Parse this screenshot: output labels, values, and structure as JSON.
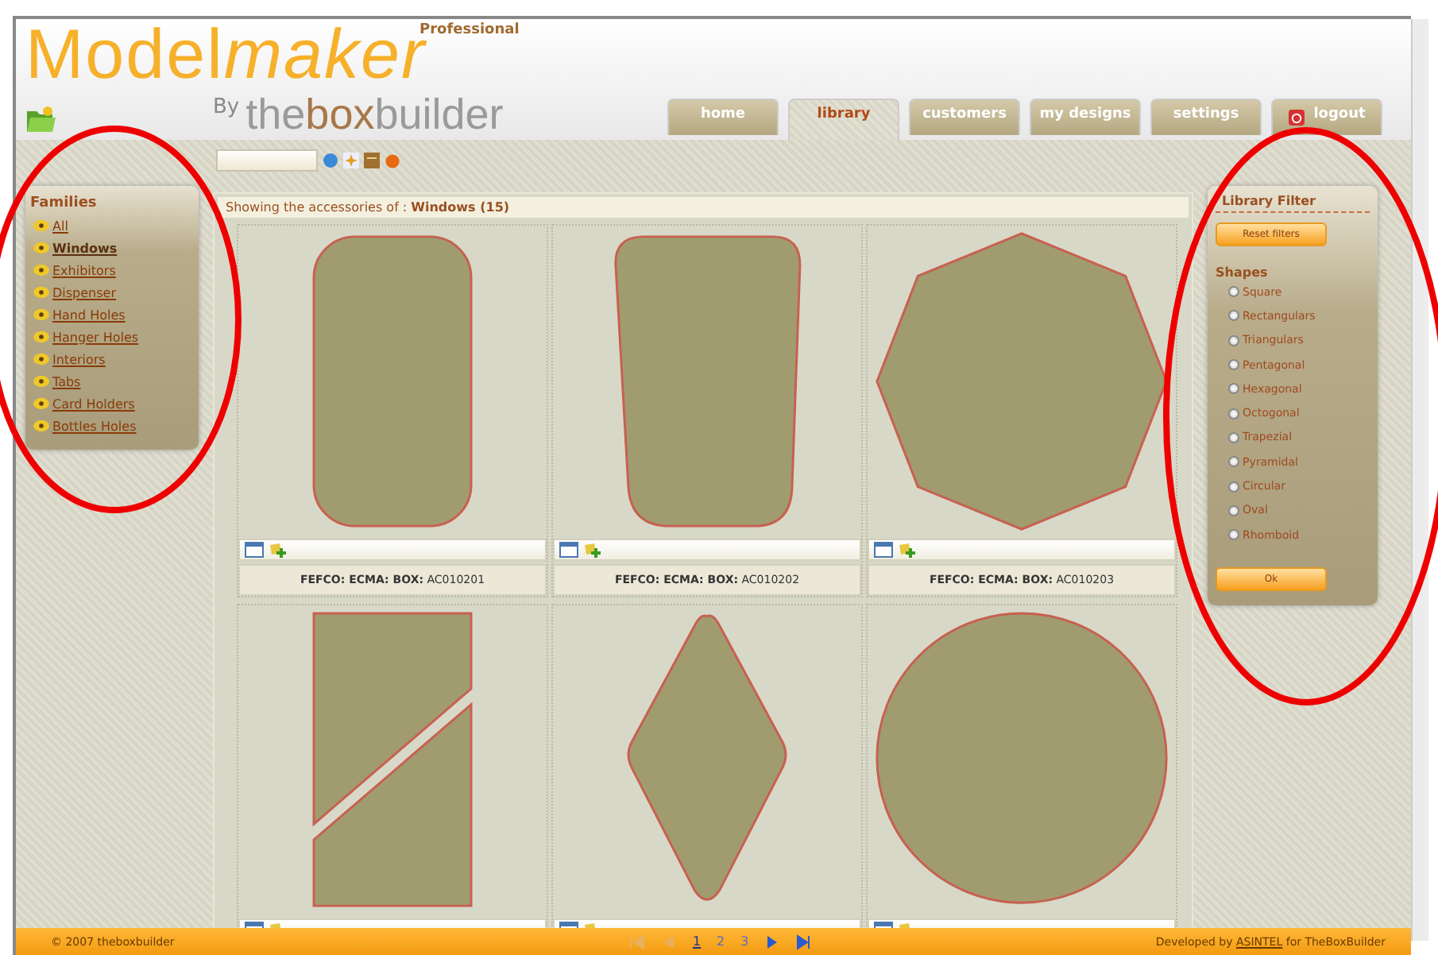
{
  "logo": {
    "brand": "Model",
    "brand_accent": "maker",
    "edition": "Professional",
    "by": "By",
    "company_a": "the",
    "company_b": "box",
    "company_c": "builder"
  },
  "tabs": [
    {
      "label": "home",
      "selected": false,
      "kind": "plain"
    },
    {
      "label": "library",
      "selected": true,
      "kind": "plain"
    },
    {
      "label": "customers",
      "selected": false,
      "kind": "plain"
    },
    {
      "label": "my designs",
      "selected": false,
      "kind": "plain"
    },
    {
      "label": "settings",
      "selected": false,
      "kind": "plain"
    },
    {
      "label": "logout",
      "selected": false,
      "kind": "logout"
    }
  ],
  "families": {
    "title": "Families",
    "items": [
      {
        "label": "All",
        "selected": false
      },
      {
        "label": "Windows",
        "selected": true
      },
      {
        "label": "Exhibitors",
        "selected": false
      },
      {
        "label": "Dispenser",
        "selected": false
      },
      {
        "label": "Hand Holes",
        "selected": false
      },
      {
        "label": "Hanger Holes",
        "selected": false
      },
      {
        "label": "Interiors",
        "selected": false
      },
      {
        "label": "Tabs",
        "selected": false
      },
      {
        "label": "Card Holders",
        "selected": false
      },
      {
        "label": "Bottles Holes",
        "selected": false
      }
    ]
  },
  "listing": {
    "heading": "Showing the accessories of : **Windows (15)**",
    "items": [
      {
        "kind": "rounded",
        "caption": "**FEFCO: ECMA: BOX:** AC010201"
      },
      {
        "kind": "trapezoid",
        "caption": "**FEFCO: ECMA: BOX:** AC010202"
      },
      {
        "kind": "octagon",
        "caption": "**FEFCO: ECMA: BOX:** AC010203"
      },
      {
        "kind": "split"
      },
      {
        "kind": "rhombus"
      },
      {
        "kind": "circle"
      }
    ]
  },
  "filter": {
    "title": "Library Filter",
    "reset_button": "Reset filters",
    "shapes_title": "Shapes",
    "options": [
      {
        "label": "Square",
        "selected": false
      },
      {
        "label": "Rectangulars",
        "selected": false
      },
      {
        "label": "Triangulars",
        "selected": false
      },
      {
        "label": "Pentagonal",
        "selected": false
      },
      {
        "label": "Hexagonal",
        "selected": false
      },
      {
        "label": "Octogonal",
        "selected": false
      },
      {
        "label": "Trapezial",
        "selected": false
      },
      {
        "label": "Pyramidal",
        "selected": false
      },
      {
        "label": "Circular",
        "selected": false
      },
      {
        "label": "Oval",
        "selected": false
      },
      {
        "label": "Rhomboid",
        "selected": false
      }
    ],
    "ok_button": "Ok"
  },
  "footer": {
    "copyright": "© 2007 theboxbuilder",
    "pages": [
      {
        "label": "1",
        "selected": true
      },
      {
        "label": "2",
        "selected": false
      },
      {
        "label": "3",
        "selected": false
      }
    ],
    "credit_prefix": "Developed by",
    "credit_link": "ASINTEL",
    "credit_suffix": "for TheBoxBuilder"
  }
}
